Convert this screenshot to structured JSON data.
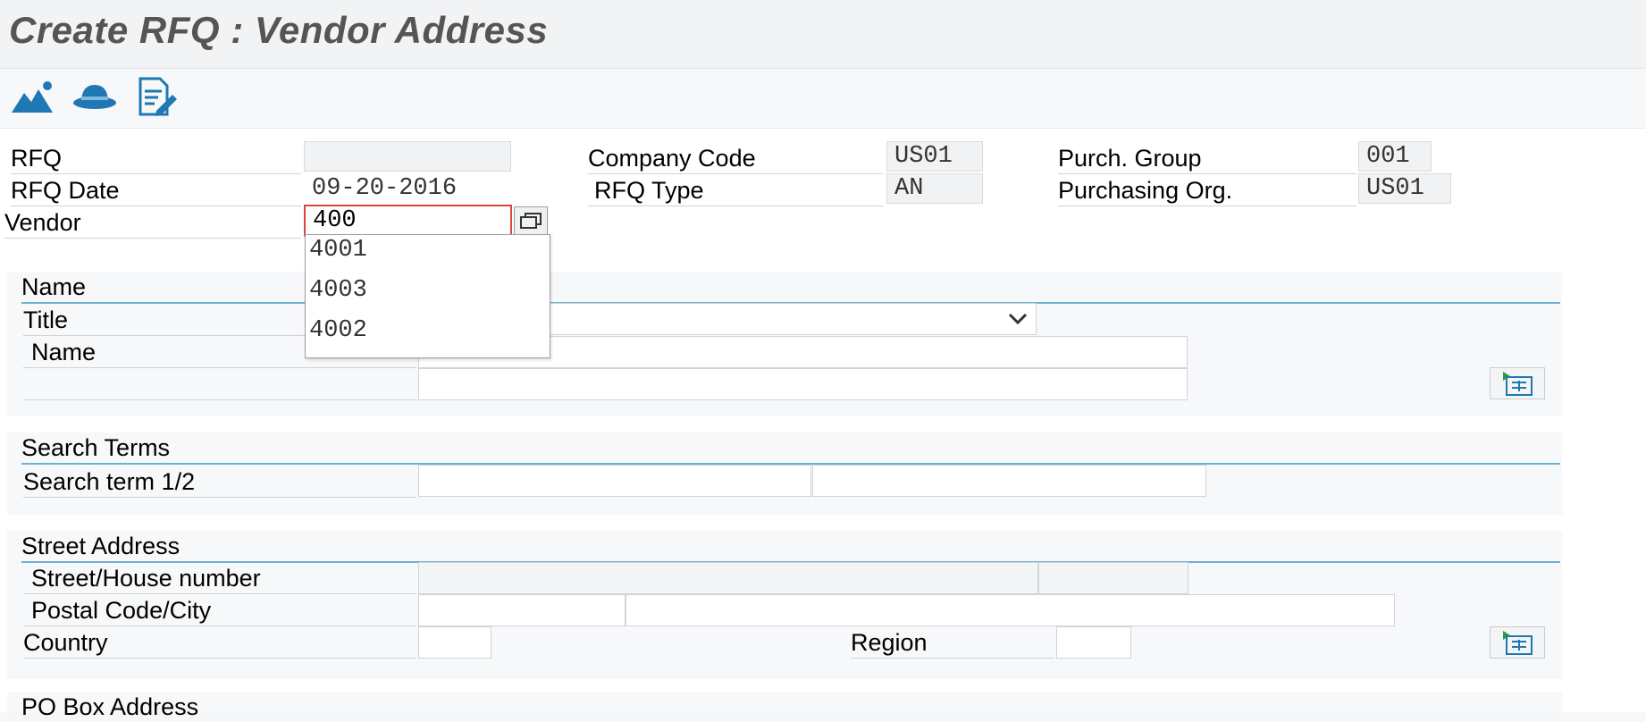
{
  "window": {
    "title": "Create RFQ : Vendor Address"
  },
  "toolbar": {
    "icons": [
      "mountain-icon",
      "hat-icon",
      "document-edit-icon"
    ]
  },
  "header": {
    "rfq": {
      "label": "RFQ",
      "value": ""
    },
    "rfq_date": {
      "label": "RFQ Date",
      "value": "09-20-2016"
    },
    "vendor": {
      "label": "Vendor",
      "value": "400"
    },
    "company_code": {
      "label": "Company Code",
      "value": "US01"
    },
    "rfq_type": {
      "label": "RFQ Type",
      "value": "AN"
    },
    "purch_group": {
      "label": "Purch. Group",
      "value": "001"
    },
    "purchasing_org": {
      "label": "Purchasing Org.",
      "value": "US01"
    }
  },
  "vendor_dropdown": {
    "options": [
      "4001",
      "4003",
      "4002"
    ]
  },
  "name_section": {
    "heading": "Name",
    "title_label": "Title",
    "name_label": "Name"
  },
  "search_section": {
    "heading": "Search Terms",
    "label": "Search term 1/2"
  },
  "street_section": {
    "heading": "Street Address",
    "street_label": "Street/House number",
    "postal_label": "Postal Code/City",
    "country_label": "Country",
    "region_label": "Region"
  },
  "pobox_section": {
    "heading": "PO Box Address"
  },
  "colors": {
    "accent_line": "#6fb1d3",
    "icon_blue": "#1f78b4",
    "error_red": "#d9463d"
  }
}
